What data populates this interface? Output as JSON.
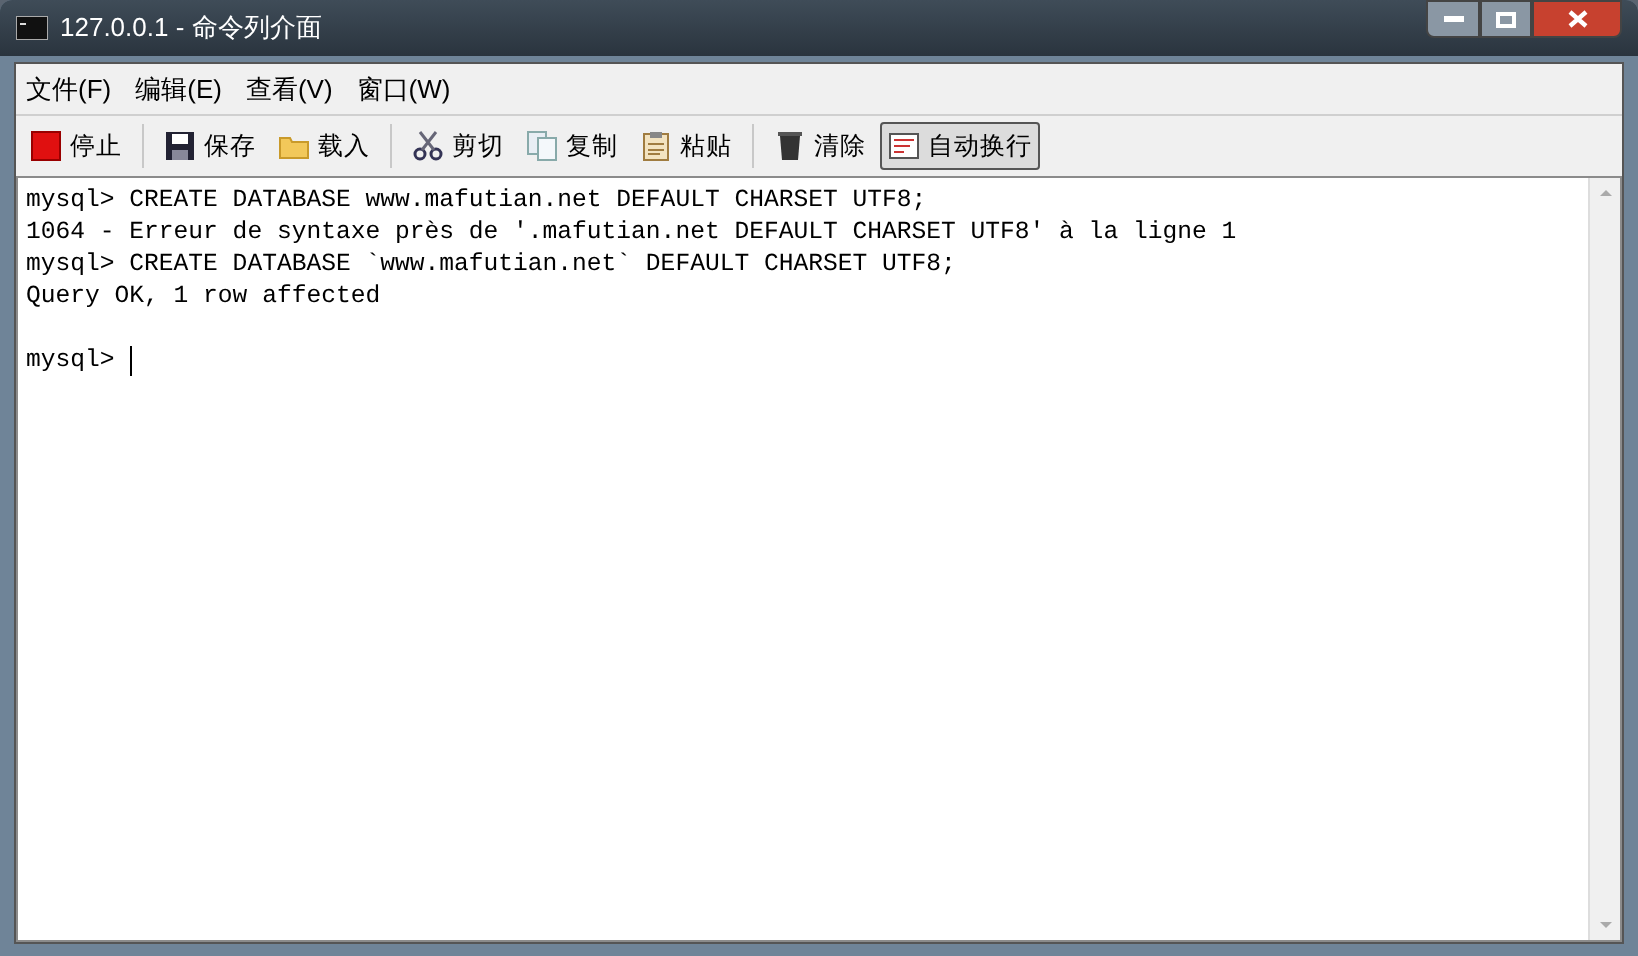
{
  "window": {
    "title": "127.0.0.1 - 命令列介面"
  },
  "menu": [
    "文件(F)",
    "编辑(E)",
    "查看(V)",
    "窗口(W)"
  ],
  "toolbar": [
    [
      {
        "kind": "stop",
        "label": "停止",
        "selected": false
      }
    ],
    [
      {
        "kind": "save",
        "label": "保存",
        "selected": false
      },
      {
        "kind": "load",
        "label": "载入",
        "selected": false
      }
    ],
    [
      {
        "kind": "cut",
        "label": "剪切",
        "selected": false
      },
      {
        "kind": "copy",
        "label": "复制",
        "selected": false
      },
      {
        "kind": "paste",
        "label": "粘贴",
        "selected": false
      }
    ],
    [
      {
        "kind": "clear",
        "label": "清除",
        "selected": false
      },
      {
        "kind": "wrap",
        "label": "自动换行",
        "selected": true
      }
    ]
  ],
  "console": {
    "lines": [
      "mysql> CREATE DATABASE www.mafutian.net DEFAULT CHARSET UTF8;",
      "1064 - Erreur de syntaxe près de '.mafutian.net DEFAULT CHARSET UTF8' à la ligne 1",
      "mysql> CREATE DATABASE `www.mafutian.net` DEFAULT CHARSET UTF8;",
      "Query OK, 1 row affected"
    ],
    "prompt": "mysql>",
    "cursor": true
  }
}
